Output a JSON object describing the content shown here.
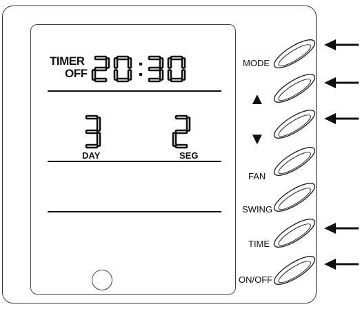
{
  "display": {
    "timer_label": "TIMER",
    "timer_sub": "OFF",
    "time": "20:30",
    "day_value": "3",
    "day_label": "DAY",
    "seg_value": "2",
    "seg_label": "SEG"
  },
  "buttons": [
    {
      "label": "MODE",
      "arrow": true
    },
    {
      "label": "▲",
      "arrow": true
    },
    {
      "label": "▼",
      "arrow": true
    },
    {
      "label": "FAN",
      "arrow": false
    },
    {
      "label": "SWING",
      "arrow": false
    },
    {
      "label": "TIME",
      "arrow": true
    },
    {
      "label": "ON/OFF",
      "arrow": true
    }
  ]
}
